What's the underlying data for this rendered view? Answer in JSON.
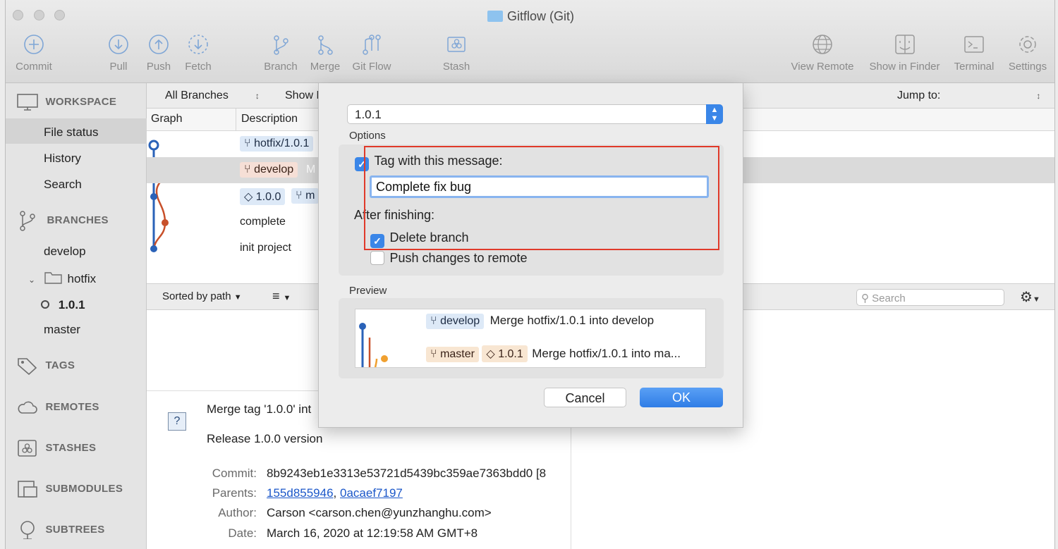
{
  "window": {
    "title": "Gitflow (Git)"
  },
  "toolbar": [
    {
      "label": "Commit",
      "icon": "plus-circle-icon"
    },
    {
      "label": "Pull",
      "icon": "arrow-down-circle-icon"
    },
    {
      "label": "Push",
      "icon": "arrow-up-circle-icon"
    },
    {
      "label": "Fetch",
      "icon": "dashed-arrow-down-circle-icon"
    },
    {
      "label": "Branch",
      "icon": "branch-icon"
    },
    {
      "label": "Merge",
      "icon": "merge-icon"
    },
    {
      "label": "Git Flow",
      "icon": "git-flow-icon"
    },
    {
      "label": "Stash",
      "icon": "stash-icon"
    },
    {
      "label": "View Remote",
      "icon": "globe-icon"
    },
    {
      "label": "Show in Finder",
      "icon": "finder-icon"
    },
    {
      "label": "Terminal",
      "icon": "terminal-icon"
    },
    {
      "label": "Settings",
      "icon": "gear-icon"
    }
  ],
  "sidebar": {
    "workspace": "WORKSPACE",
    "workspace_items": [
      "File status",
      "History",
      "Search"
    ],
    "branches": "BRANCHES",
    "branch_items": {
      "develop": "develop",
      "hotfix_folder": "hotfix",
      "hotfix_branch": "1.0.1",
      "master": "master"
    },
    "tags": "TAGS",
    "remotes": "REMOTES",
    "stashes": "STASHES",
    "submodules": "SUBMODULES",
    "subtrees": "SUBTREES"
  },
  "filterbar": {
    "branches": "All Branches",
    "show": "Show F",
    "jump": "Jump to:"
  },
  "columns": {
    "graph": "Graph",
    "description": "Description"
  },
  "commits": [
    {
      "tags": [
        "hotfix/1.0.1"
      ],
      "text": ""
    },
    {
      "tags": [
        "develop"
      ],
      "text": "M"
    },
    {
      "tags": [
        "1.0.0",
        "m"
      ],
      "text": ""
    },
    {
      "tags": [],
      "text": "complete"
    },
    {
      "tags": [],
      "text": "init project"
    }
  ],
  "sortbar": {
    "sort": "Sorted by path",
    "search_placeholder": "Search"
  },
  "details": {
    "subject": "Merge tag '1.0.0' int",
    "body": "Release 1.0.0 version",
    "labels": {
      "commit": "Commit:",
      "parents": "Parents:",
      "author": "Author:",
      "date": "Date:"
    },
    "commit": "8b9243eb1e3313e53721d5439bc359ae7363bdd0 [8",
    "parent1": "155d855946",
    "parent2": "0acaef7197",
    "author": "Carson <carson.chen@yunzhanghu.com>",
    "date": "March 16, 2020 at 12:19:58 AM GMT+8"
  },
  "dialog": {
    "version": "1.0.1",
    "options_label": "Options",
    "tag_with_message": "Tag with this message:",
    "tag_message": "Complete fix bug",
    "after_finishing": "After finishing:",
    "delete_branch": "Delete branch",
    "push_changes": "Push changes to remote",
    "preview_label": "Preview",
    "preview": [
      {
        "tags": [
          "develop"
        ],
        "text": "Merge hotfix/1.0.1 into develop"
      },
      {
        "tags": [
          "master",
          "1.0.1"
        ],
        "text": "Merge hotfix/1.0.1 into ma..."
      }
    ],
    "cancel": "Cancel",
    "ok": "OK"
  },
  "colors": {
    "accent": "#3a86e8",
    "highlight_box": "#e03a2a",
    "blue_line": "#2a62b8",
    "orange_line": "#c8502a"
  }
}
